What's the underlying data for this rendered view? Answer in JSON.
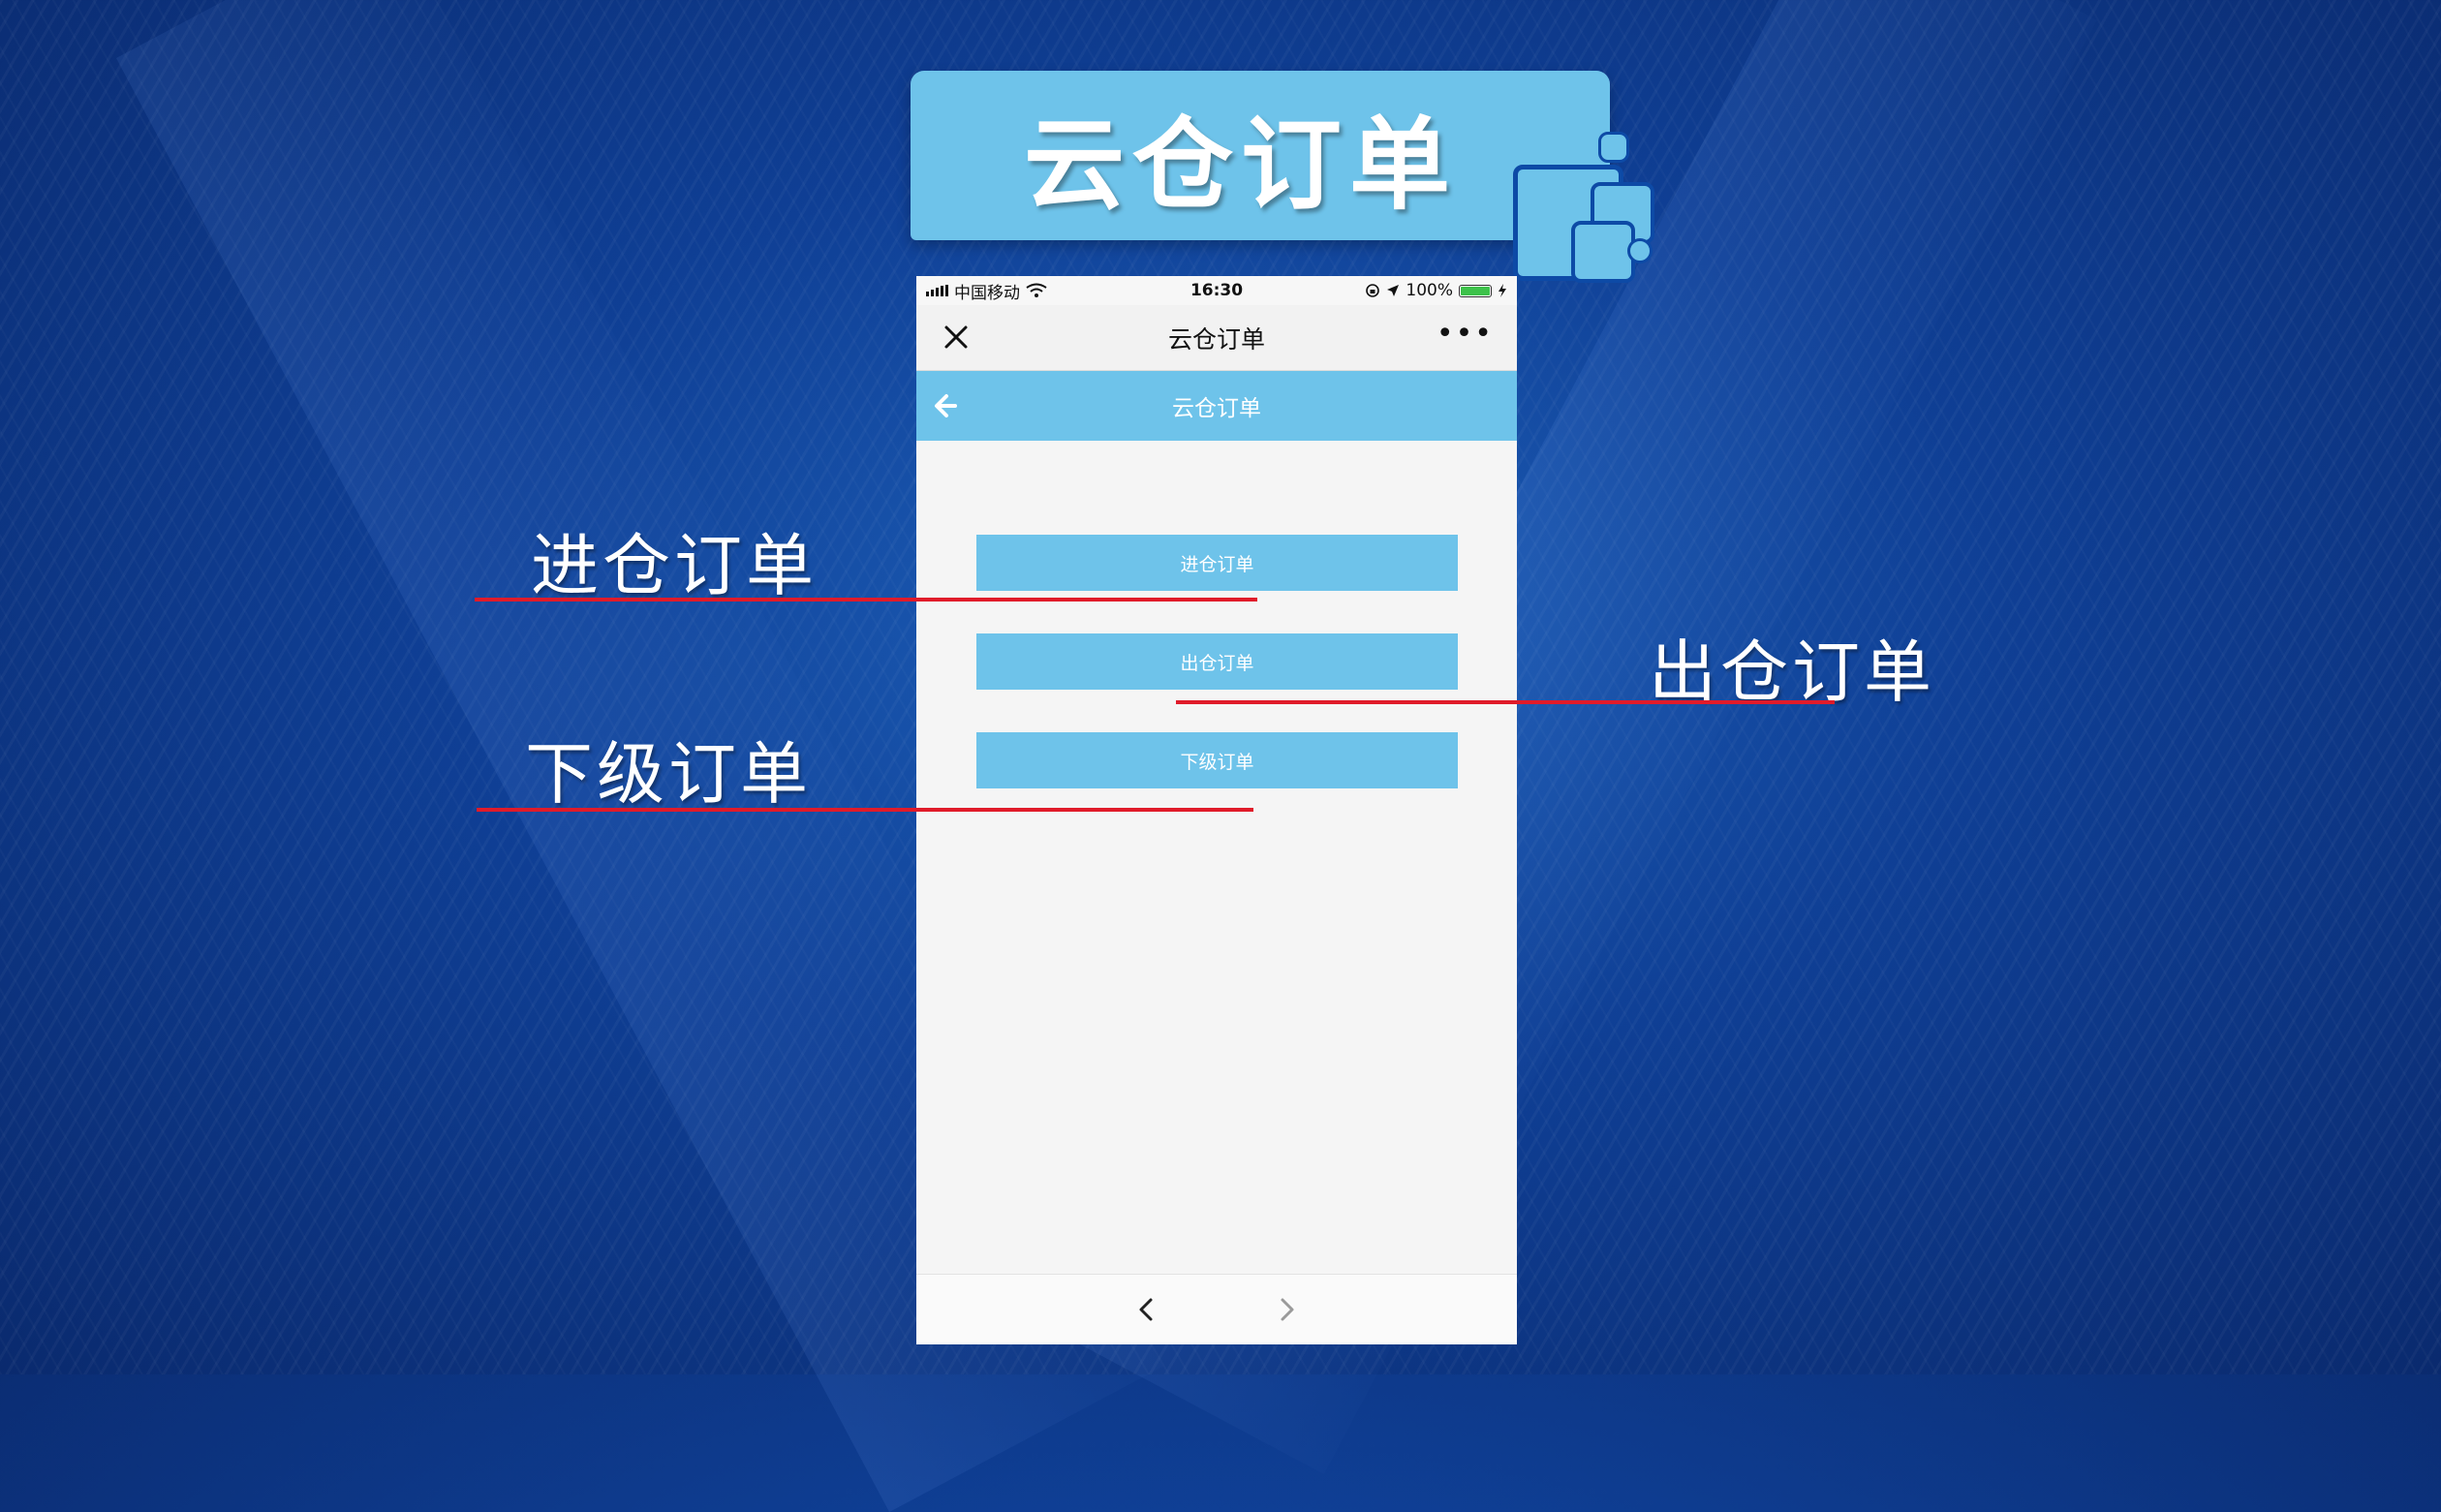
{
  "banner": {
    "title": "云仓订单"
  },
  "status_bar": {
    "carrier": "中国移动",
    "time": "16:30",
    "battery": "100%",
    "icons": [
      "signal-icon",
      "wifi-icon",
      "orientation-lock-icon",
      "location-icon",
      "battery-icon",
      "charging-icon"
    ]
  },
  "navbar": {
    "title": "云仓订单",
    "close_icon": "close-icon",
    "more_icon": "more-icon",
    "more_label": "•••"
  },
  "appbar": {
    "title": "云仓订单",
    "back_icon": "back-arrow-icon"
  },
  "menu": {
    "inbound_label": "进仓订单",
    "outbound_label": "出仓订单",
    "subordinate_label": "下级订单"
  },
  "bottom_bar": {
    "back_icon": "chevron-left-icon",
    "forward_icon": "chevron-right-icon"
  },
  "annotations": {
    "inbound": "进仓订单",
    "outbound": "出仓订单",
    "subordinate": "下级订单",
    "line_color": "#e01b2a"
  },
  "colors": {
    "accent": "#6ec3ea",
    "background": "#0f3f95",
    "battery": "#3dc24a"
  }
}
